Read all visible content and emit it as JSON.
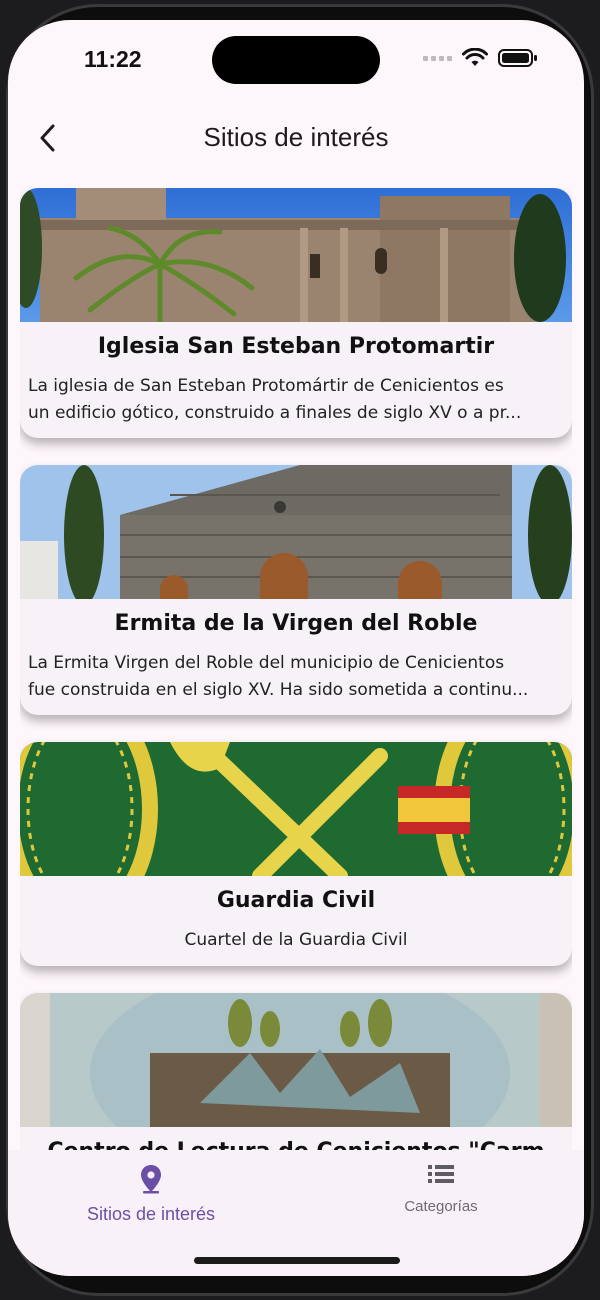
{
  "status_bar": {
    "time": "11:22"
  },
  "header": {
    "title": "Sitios de interés"
  },
  "places": [
    {
      "title": "Iglesia San Esteban Protomartir",
      "desc_line1": "La iglesia de San Esteban Protomártir de Cenicientos es",
      "desc_line2": "un edificio gótico, construido a finales de siglo XV o a pr..."
    },
    {
      "title": "Ermita de la Virgen del Roble",
      "desc_line1": "La Ermita Virgen del Roble del municipio de Cenicientos",
      "desc_line2": "fue construida en el siglo XV. Ha sido sometida a continu..."
    },
    {
      "title": "Guardia Civil",
      "desc_line1": "Cuartel de la Guardia Civil"
    },
    {
      "title": "Centro de Lectura de Cenicientos \"Carm"
    }
  ],
  "bottom_nav": {
    "items": [
      {
        "label": "Sitios de interés",
        "icon": "location-pin-icon",
        "active": true
      },
      {
        "label": "Categorías",
        "icon": "list-icon",
        "active": false
      }
    ]
  },
  "colors": {
    "accent": "#6b4fa6",
    "background": "#fdf6fb",
    "card": "#f7f2f8"
  }
}
